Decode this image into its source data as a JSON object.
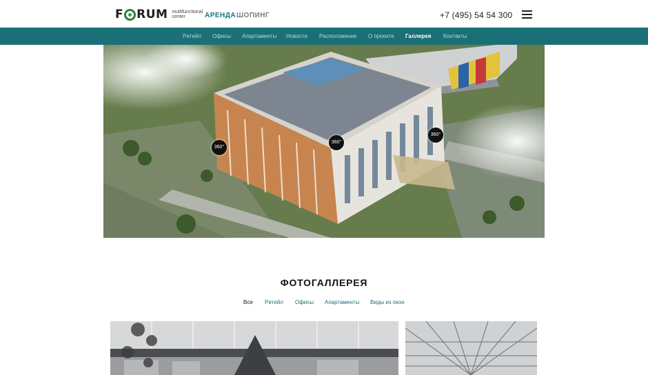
{
  "header": {
    "logo_word_f": "F",
    "logo_word_rest": "RUM",
    "logo_sub_1": "multifunctional",
    "logo_sub_2": "center",
    "nav_rent": "АРЕНДА",
    "nav_shop": "ШОПИНГ",
    "phone": "+7 (495) 54 54 300",
    "menu_icon": "hamburger-menu-icon"
  },
  "navbar": {
    "items": [
      {
        "label": "Ритейл"
      },
      {
        "label": "Офисы"
      },
      {
        "label": "Апартаменты"
      },
      {
        "label": "Новости"
      },
      {
        "label": "Расположение"
      },
      {
        "label": "О проекте"
      },
      {
        "label": "Галлерея",
        "active": true
      },
      {
        "label": "Контакты"
      }
    ]
  },
  "hero": {
    "image": "aerial view of multifunctional center building",
    "pins": [
      {
        "label": "360°"
      },
      {
        "label": "360°"
      },
      {
        "label": "360°"
      }
    ]
  },
  "gallery": {
    "title": "ФОТОГАЛЛЕРЕЯ",
    "filters": [
      {
        "label": "Все",
        "active": true
      },
      {
        "label": "Ритейл"
      },
      {
        "label": "Офисы"
      },
      {
        "label": "Апартаменты"
      },
      {
        "label": "Виды из окон"
      }
    ]
  },
  "colors": {
    "accent": "#1b7078",
    "logo_green": "#2e7d3a"
  }
}
